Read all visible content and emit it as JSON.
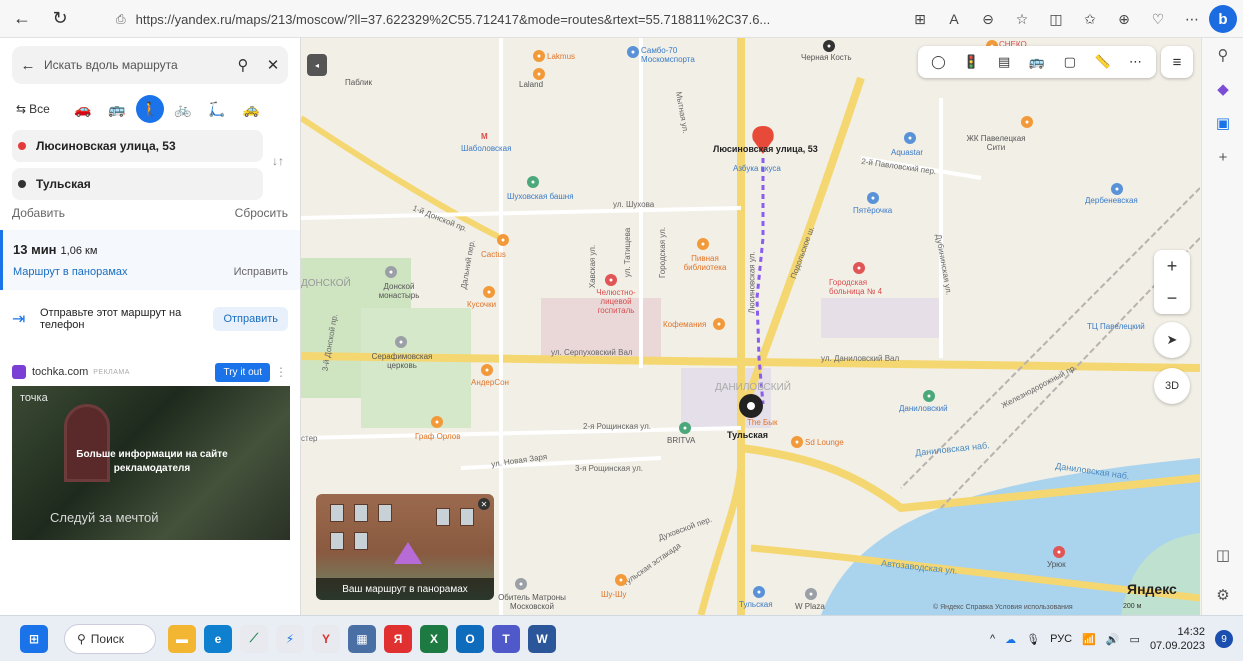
{
  "browser": {
    "back_icon": "back-arrow-icon",
    "url": "https://yandex.ru/maps/213/moscow/?ll=37.622329%2C55.712417&mode=routes&rtext=55.718811%2C37.6...",
    "bing_label": "b"
  },
  "panel": {
    "search_placeholder": "Искать вдоль маршрута",
    "modes": {
      "all_label": "Все"
    },
    "from": "Люсиновская улица, 53",
    "to": "Тульская",
    "add_label": "Добавить",
    "reset_label": "Сбросить",
    "route": {
      "time": "13 мин",
      "distance": "1,06 км",
      "panorama_link": "Маршрут в панорамах",
      "fix_link": "Исправить"
    },
    "send": {
      "text": "Отправьте этот маршрут на телефон",
      "button": "Отправить"
    },
    "ad": {
      "site": "tochka.com",
      "tag": "РЕКЛАМА",
      "cta": "Try it out",
      "brand": "точка",
      "message": "Больше информации на сайте рекламодателя",
      "slogan": "Следуй за мечтой"
    }
  },
  "map": {
    "labels": {
      "paveletskaya_city": "ЖК Павелецкая Сити",
      "lyusinovskaya_pin": "Люсиновская улица, 53",
      "azbuka": "Азбука вкуса",
      "shabolovskaya": "Шаболовская",
      "shukhov": "Шуховская башня",
      "shukhova_st": "ул. Шухова",
      "lakmus": "Lakmus",
      "sambo": "Самбо-70 Москомспорта",
      "laland": "Laland",
      "chernaya_kost": "Черная Кость",
      "cactus": "Cactus",
      "pivnaya": "Пивная библиотека",
      "donskoy_monastery": "Донской монастырь",
      "kusochki": "Кусочки",
      "chelyustno": "Челюстно-лицевой госпиталь",
      "kofemania": "Кофемания",
      "hospital4": "Городская больница № 4",
      "pyaterochka": "Пятёрочка",
      "aquastar": "Aquastar",
      "derbenevskaya": "Дербеневская",
      "serafim": "Серафимовская церковь",
      "serpukhov_val": "ул. Серпуховский Вал",
      "danilov_val": "ул. Даниловский Вал",
      "andersen": "АндерСон",
      "danilovsky": "ДАНИЛОВСКИЙ",
      "danilovsky_market": "Даниловский",
      "graf_orlov": "Граф Орлов",
      "britva": "BRITVA",
      "tulskaya_pin": "Тульская",
      "the_byk": "The Бык",
      "sd_lounge": "Sd Lounge",
      "danilovskaya_nab": "Даниловская наб.",
      "danilovskaya_nab2": "Даниловская наб.",
      "avtozavodskaya": "Автозаводская ул.",
      "urok": "Урюк",
      "tulskaya_metro": "Тульская",
      "w_plaza": "W Plaza",
      "shu_shu": "Шу-Шу",
      "matrona": "Обитель Матроны Московской",
      "tc_paveletsky": "ТЦ Павелецкий",
      "novaya_zarya": "ул. Новая Заря",
      "roshchinskaya2": "2-я Рощинская ул.",
      "roshchinskaya3": "3-я Рощинская ул.",
      "duhovskoy": "Духовской пер.",
      "tulskaya_estakada": "Тульская эстакада",
      "podolskoe": "Подольское ш.",
      "lyusinovskaya_st": "Люсиновская ул.",
      "mytnaya": "Мытная ул.",
      "pavlovsky": "2-й Павловский пер.",
      "dubininskaya": "Дубининская ул.",
      "zheleznodorozhny": "Железнодорожный пр.",
      "donskoy1": "1-й Донской пр.",
      "donskoy3": "3-й Донской пр.",
      "kavskaya": "Хавская ул.",
      "tatishcheva": "ул. Татищева",
      "gorodskaya": "Городская ул.",
      "dalniy": "Дальний пер.",
      "pablik": "Паблик",
      "donskoy_area": "ДОНСКОЙ",
      "master": "стер",
      "fo": "Fo",
      "sklad": "СНЕКО"
    },
    "panorama_caption": "Ваш маршрут в панорамах",
    "logo": "Яндекс",
    "copyright": "© Яндекс  Справка  Условия использования",
    "scale": "200 м",
    "button_3d": "3D"
  },
  "taskbar": {
    "search_label": "Поиск",
    "lang": "РУС",
    "time": "14:32",
    "date": "07.09.2023",
    "notifications": "9"
  }
}
